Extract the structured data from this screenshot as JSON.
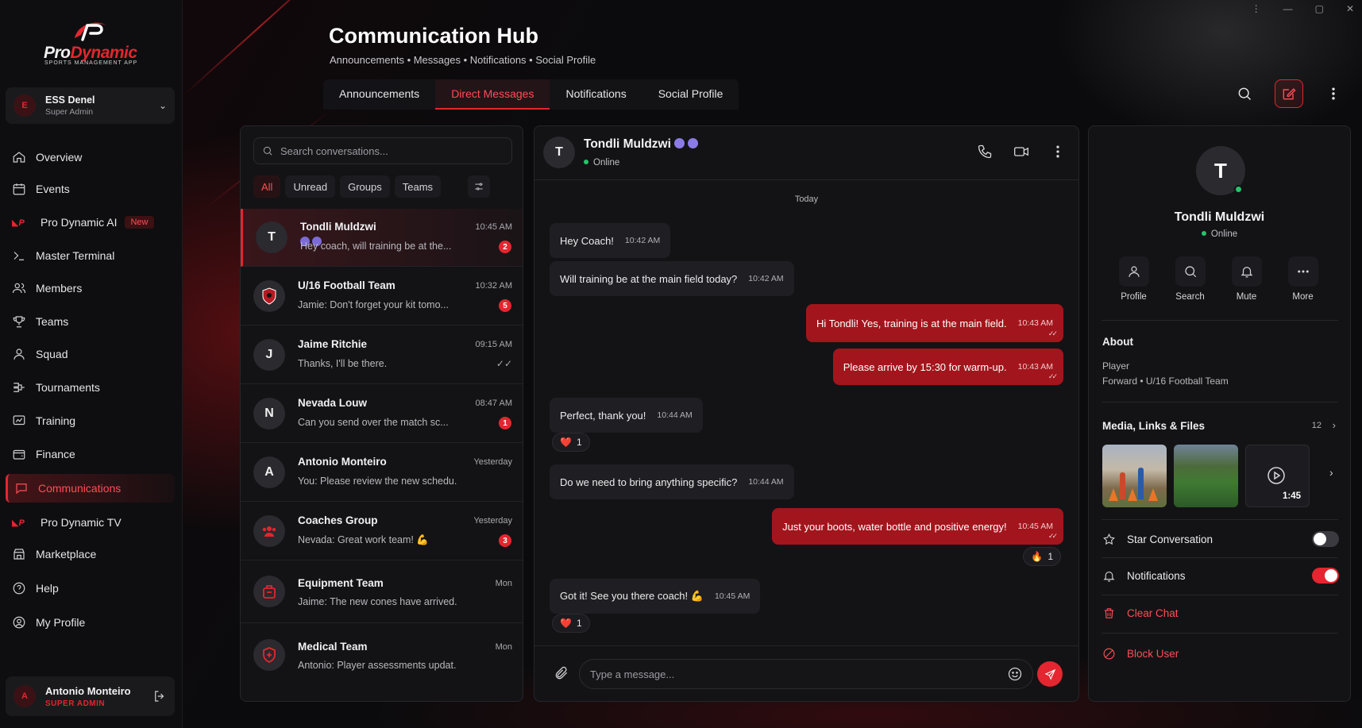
{
  "window": {
    "controls": [
      "⋮",
      "—",
      "▢",
      "✕"
    ]
  },
  "brand": {
    "name_a": "Pro",
    "name_b": "Dynamic",
    "tagline": "SPORTS MANAGEMENT APP",
    "accent": "#e3262f"
  },
  "account": {
    "initial": "E",
    "name": "ESS Denel",
    "role": "Super Admin"
  },
  "nav": [
    {
      "label": "Overview",
      "icon": "home-icon"
    },
    {
      "label": "Events",
      "icon": "calendar-icon"
    },
    {
      "label": "Pro Dynamic AI",
      "icon": "prodynamic-logo-icon",
      "badge": "New"
    },
    {
      "label": "Master Terminal",
      "icon": "terminal-icon"
    },
    {
      "label": "Members",
      "icon": "users-icon"
    },
    {
      "label": "Teams",
      "icon": "trophy-icon"
    },
    {
      "label": "Squad",
      "icon": "user-icon"
    },
    {
      "label": "Tournaments",
      "icon": "bracket-icon"
    },
    {
      "label": "Training",
      "icon": "training-icon"
    },
    {
      "label": "Finance",
      "icon": "wallet-icon"
    },
    {
      "label": "Communications",
      "icon": "chat-icon",
      "active": true
    },
    {
      "label": "Pro Dynamic TV",
      "icon": "prodynamic-logo-icon"
    },
    {
      "label": "Marketplace",
      "icon": "store-icon"
    },
    {
      "label": "Help",
      "icon": "help-icon"
    },
    {
      "label": "My Profile",
      "icon": "profile-icon"
    }
  ],
  "bottom_user": {
    "initial": "A",
    "name": "Antonio Monteiro",
    "role": "SUPER ADMIN"
  },
  "header": {
    "title": "Communication Hub",
    "subtitle": "Announcements • Messages • Notifications • Social Profile",
    "tabs": [
      "Announcements",
      "Direct Messages",
      "Notifications",
      "Social Profile"
    ],
    "active_tab": "Direct Messages"
  },
  "conversations": {
    "search_placeholder": "Search conversations...",
    "filters": [
      "All",
      "Unread",
      "Groups",
      "Teams"
    ],
    "active_filter": "All",
    "items": [
      {
        "name": "Tondli Muldzwi",
        "preview": "Hey coach, will training be at the...",
        "time": "10:45 AM",
        "unread": "2",
        "initial": "T",
        "active": true
      },
      {
        "name": "U/16 Football Team",
        "preview": "Jamie: Don't forget your kit tomo...",
        "time": "10:32 AM",
        "unread": "5",
        "icon": "team-crest-icon"
      },
      {
        "name": "Jaime Ritchie",
        "preview": "Thanks, I'll be there.",
        "time": "09:15 AM",
        "initial": "J",
        "read": "✓✓"
      },
      {
        "name": "Nevada Louw",
        "preview": "Can you send over the match sc...",
        "time": "08:47 AM",
        "unread": "1",
        "initial": "N"
      },
      {
        "name": "Antonio Monteiro",
        "preview": "You: Please review the new schedu...",
        "time": "Yesterday",
        "initial": "A"
      },
      {
        "name": "Coaches Group",
        "preview": "Nevada: Great work team! 💪",
        "time": "Yesterday",
        "unread": "3",
        "icon": "group-icon"
      },
      {
        "name": "Equipment Team",
        "preview": "Jaime: The new cones have arrived.",
        "time": "Mon",
        "icon": "bag-icon"
      },
      {
        "name": "Medical Team",
        "preview": "Antonio: Player assessments updat...",
        "time": "Mon",
        "icon": "medical-shield-icon"
      }
    ]
  },
  "chat": {
    "contact": {
      "initial": "T",
      "name": "Tondli Muldzwi",
      "status": "Online"
    },
    "day_label": "Today",
    "messages": [
      {
        "dir": "in",
        "text": "Hey Coach!",
        "time": "10:42 AM"
      },
      {
        "dir": "in",
        "text": "Will training be at the main field today?",
        "time": "10:42 AM"
      },
      {
        "dir": "out",
        "text": "Hi Tondli! Yes, training is at the main field.",
        "time": "10:43 AM"
      },
      {
        "dir": "out",
        "text": "Please arrive by 15:30 for warm-up.",
        "time": "10:43 AM"
      },
      {
        "dir": "in",
        "text": "Perfect, thank you!",
        "time": "10:44 AM",
        "reaction": {
          "emoji": "❤️",
          "count": "1"
        }
      },
      {
        "dir": "in",
        "text": "Do we need to bring anything specific?",
        "time": "10:44 AM"
      },
      {
        "dir": "out",
        "text": "Just your boots, water bottle and positive energy!",
        "time": "10:45 AM",
        "reaction": {
          "emoji": "🔥",
          "count": "1"
        }
      },
      {
        "dir": "in",
        "text": "Got it! See you there coach! 💪",
        "time": "10:45 AM",
        "reaction": {
          "emoji": "❤️",
          "count": "1"
        }
      }
    ],
    "composer_placeholder": "Type a message..."
  },
  "profile": {
    "initial": "T",
    "name": "Tondli Muldzwi",
    "status": "Online",
    "actions": [
      "Profile",
      "Search",
      "Mute",
      "More"
    ],
    "about_heading": "About",
    "about_role": "Player",
    "about_detail": "Forward • U/16 Football Team",
    "media_heading": "Media, Links & Files",
    "media_count": "12",
    "video_duration": "1:45",
    "star_label": "Star Conversation",
    "star_on": false,
    "notifications_label": "Notifications",
    "notifications_on": true,
    "clear_label": "Clear Chat",
    "block_label": "Block User"
  }
}
